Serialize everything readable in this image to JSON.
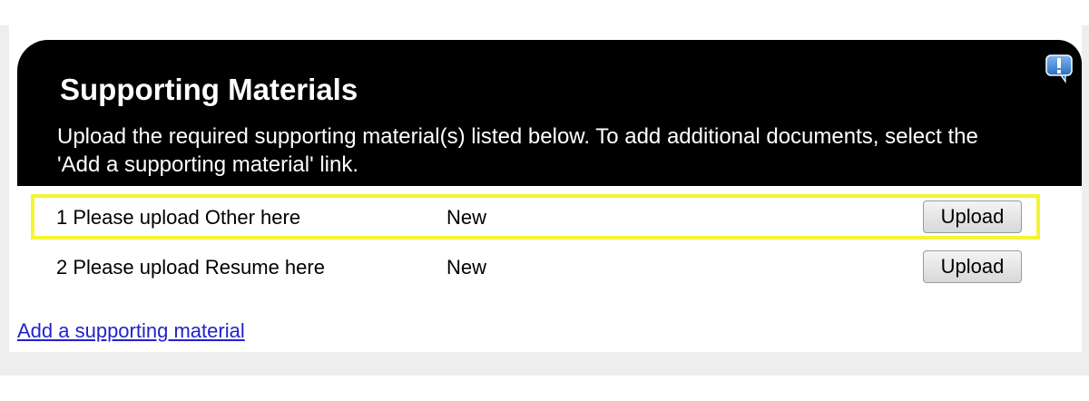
{
  "header": {
    "title": "Supporting Materials",
    "description": "Upload the required supporting material(s) listed below.  To add additional documents, select the 'Add a supporting material' link.",
    "help_icon": "help-speech-bubble-icon"
  },
  "materials": [
    {
      "label": "1 Please upload Other here",
      "status": "New",
      "button": "Upload",
      "highlighted": true
    },
    {
      "label": "2 Please upload Resume here",
      "status": "New",
      "button": "Upload",
      "highlighted": false
    }
  ],
  "add_link": "Add a supporting material",
  "colors": {
    "header_bg": "#000000",
    "highlight": "#f4f434",
    "link": "#2222cc"
  }
}
